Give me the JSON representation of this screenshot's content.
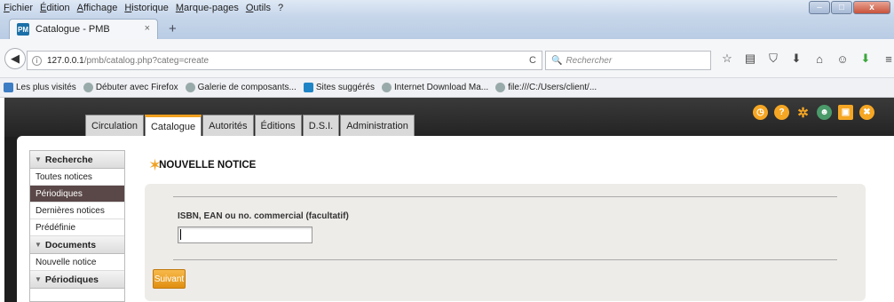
{
  "menubar": [
    "Fichier",
    "Édition",
    "Affichage",
    "Historique",
    "Marque-pages",
    "Outils",
    "?"
  ],
  "window_controls": {
    "minimize": "–",
    "maximize": "□",
    "close": "x"
  },
  "browser_tab": {
    "favicon_text": "PM",
    "title": "Catalogue - PMB",
    "close": "×",
    "new_tab": "+"
  },
  "navbar": {
    "back": "◀",
    "url_prefix": "127.0.0.1",
    "url_rest": "/pmb/catalog.php?categ=create",
    "reload": "C",
    "search_placeholder": "Rechercher",
    "search_icon": "🔍"
  },
  "toolbar_icons": [
    "star-icon",
    "clipboard-icon",
    "pocket-icon",
    "download-icon",
    "home-icon",
    "chat-icon",
    "extension-icon",
    "menu-icon"
  ],
  "toolbar_glyphs": [
    "☆",
    "▤",
    "⛉",
    "⬇",
    "⌂",
    "☺",
    "⬇",
    "≡"
  ],
  "bookmarks": [
    {
      "label": "Les plus visités",
      "icon": "bookmark-icon"
    },
    {
      "label": "Débuter avec Firefox",
      "icon": "globe-icon"
    },
    {
      "label": "Galerie de composants...",
      "icon": "globe-icon"
    },
    {
      "label": "Sites suggérés",
      "icon": "sites-icon"
    },
    {
      "label": "Internet Download Ma...",
      "icon": "globe-icon"
    },
    {
      "label": "file:///C:/Users/client/...",
      "icon": "globe-icon"
    }
  ],
  "main_nav": [
    {
      "label": "Circulation",
      "active": false
    },
    {
      "label": "Catalogue",
      "active": true
    },
    {
      "label": "Autorités",
      "active": false
    },
    {
      "label": "Éditions",
      "active": false
    },
    {
      "label": "D.S.I.",
      "active": false
    },
    {
      "label": "Administration",
      "active": false
    }
  ],
  "header_icons": [
    {
      "name": "clock-icon",
      "glyph": "◷",
      "color": "#f5a623"
    },
    {
      "name": "help-icon",
      "glyph": "?",
      "color": "#f5a623"
    },
    {
      "name": "settings-icon",
      "glyph": "✲",
      "color": "#f5a623"
    },
    {
      "name": "user-icon",
      "glyph": "☻",
      "color": "#4a9a6a"
    },
    {
      "name": "save-icon",
      "glyph": "▣",
      "color": "#f5a623"
    },
    {
      "name": "logout-icon",
      "glyph": "✖",
      "color": "#f5a623"
    }
  ],
  "sidebar": {
    "sections": [
      {
        "title": "Recherche",
        "items": [
          {
            "label": "Toutes notices",
            "active": false
          },
          {
            "label": "Périodiques",
            "active": true
          },
          {
            "label": "Dernières notices",
            "active": false
          },
          {
            "label": "Prédéfinie",
            "active": false
          }
        ]
      },
      {
        "title": "Documents",
        "items": [
          {
            "label": "Nouvelle notice",
            "active": false
          }
        ]
      },
      {
        "title": "Périodiques",
        "items": []
      }
    ]
  },
  "main": {
    "title": "NOUVELLE NOTICE",
    "field_label": "ISBN, EAN ou no. commercial (facultatif)",
    "field_value": "",
    "submit_label": "Suivant"
  },
  "colors": {
    "accent": "#f0a020",
    "active_sidebar": "#5a4747",
    "header_bg": "#232323"
  }
}
